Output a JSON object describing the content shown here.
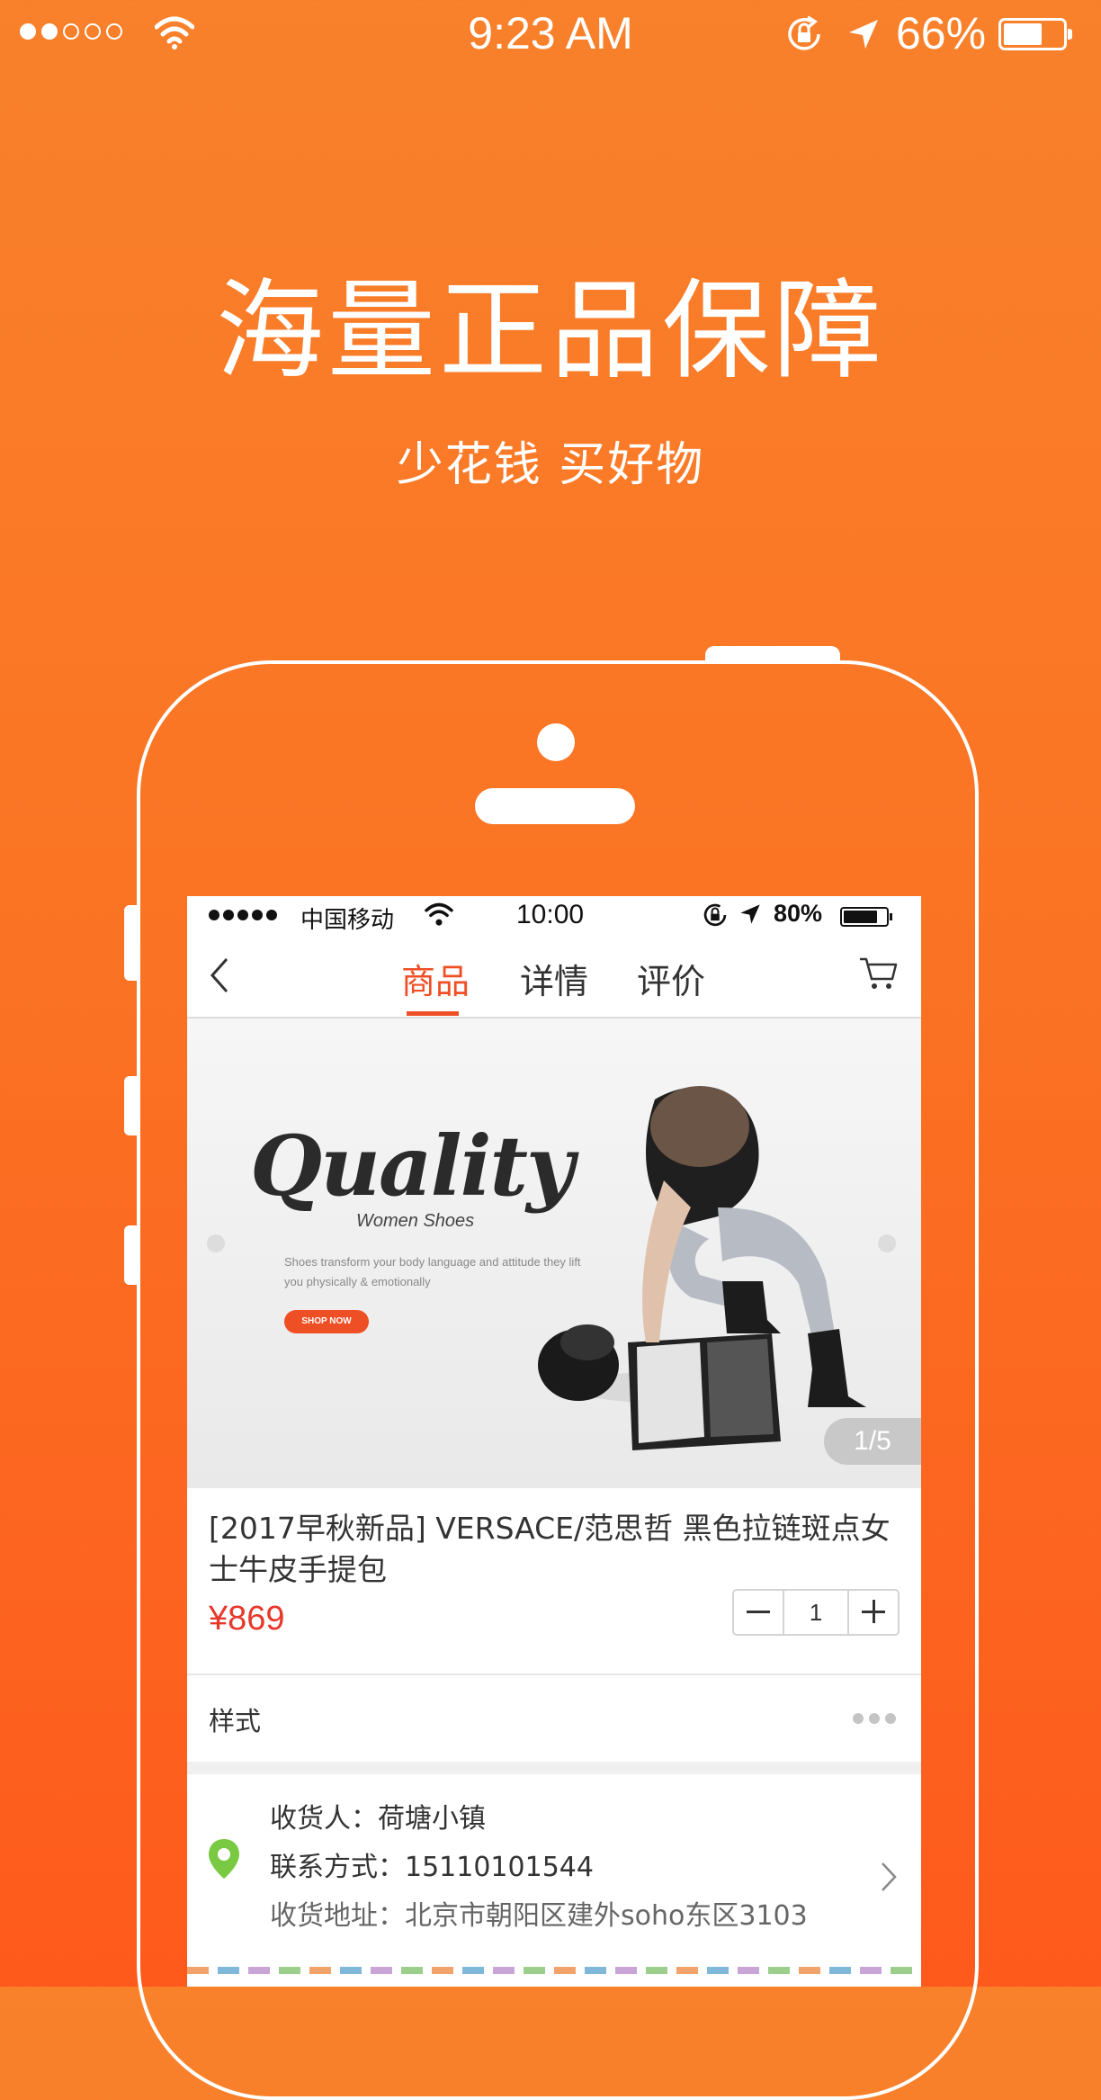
{
  "status_bar": {
    "time": "9:23 AM",
    "battery": "66%",
    "battery_level": 0.66,
    "signal_filled": 2,
    "signal_total": 5
  },
  "promo": {
    "headline": "海量正品保障",
    "subline": "少花钱 买好物"
  },
  "phone_screen": {
    "status": {
      "carrier": "中国移动",
      "time": "10:00",
      "battery": "80%",
      "battery_level": 0.8
    },
    "nav": {
      "tabs": [
        {
          "label": "商品",
          "active": true
        },
        {
          "label": "详情",
          "active": false
        },
        {
          "label": "评价",
          "active": false
        }
      ]
    },
    "banner": {
      "title": "Quality",
      "subtitle": "Women Shoes",
      "description": "Shoes transform your body language and attitude they lift you physically & emotionally",
      "cta": "SHOP NOW",
      "page_indicator": "1/5"
    },
    "product": {
      "title": "[2017早秋新品] VERSACE/范思哲 黑色拉链斑点女士牛皮手提包",
      "price": "¥869",
      "quantity": "1"
    },
    "style_row": {
      "label": "样式"
    },
    "address": {
      "recipient": "收货人：荷塘小镇",
      "contact": "联系方式：15110101544",
      "address": "收货地址：北京市朝阳区建外soho东区3103"
    }
  },
  "colors": {
    "brand_orange": "#fa7424",
    "accent_red": "#ef4f25",
    "price_red": "#e8382b",
    "pin_green": "#7ac943"
  }
}
